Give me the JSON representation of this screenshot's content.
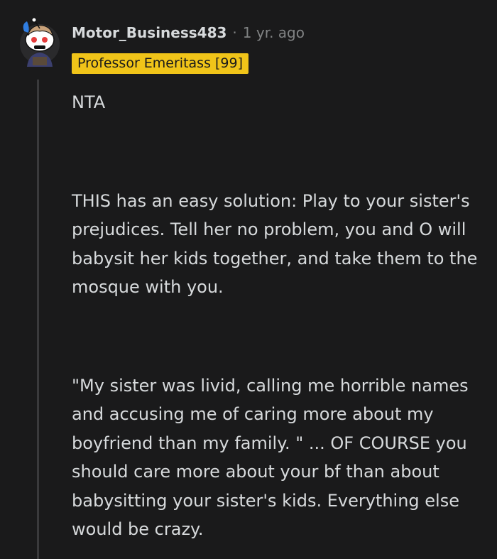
{
  "comment": {
    "author": "Motor_Business483",
    "separator": "·",
    "timestamp": "1 yr. ago",
    "flair": "Professor Emeritass [99]",
    "paragraphs": [
      "NTA",
      "THIS has an easy solution: Play to your sister's prejudices. Tell her no problem, you and O will babysit her kids together, and take them to the mosque with you.",
      "\"My sister was livid, calling me horrible names and accusing me of caring more about my boyfriend than my family. \" ... OF COURSE you should care more about your bf than about babysitting your sister's kids. Everything else would be crazy."
    ]
  },
  "colors": {
    "background": "#1a1a1b",
    "text": "#d7dadc",
    "muted": "#818384",
    "flair_bg": "#f0c419",
    "thread_line": "#3a3a3c"
  },
  "icons": {
    "avatar": "snoo-avatar-icon"
  }
}
